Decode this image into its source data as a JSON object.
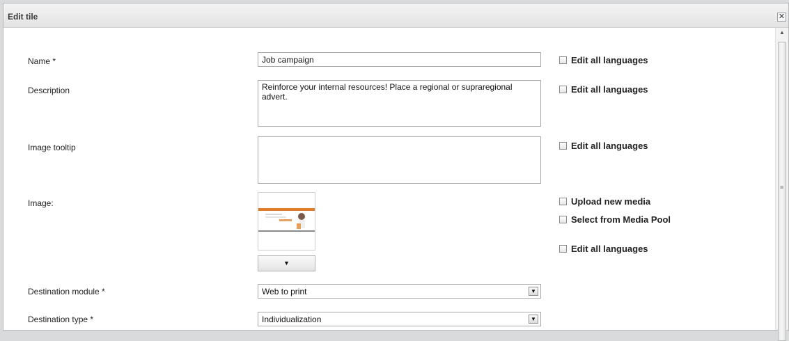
{
  "dialog": {
    "title": "Edit tile",
    "close_glyph": "✕"
  },
  "form": {
    "name": {
      "label": "Name *",
      "value": "Job campaign"
    },
    "description": {
      "label": "Description",
      "value": "Reinforce your internal resources! Place a regional or supraregional advert."
    },
    "image_tooltip": {
      "label": "Image tooltip",
      "value": ""
    },
    "image": {
      "label": "Image:",
      "dropdown_glyph": "▼"
    },
    "destination_module": {
      "label": "Destination module *",
      "value": "Web to print"
    },
    "destination_type": {
      "label": "Destination type *",
      "value": "Individualization"
    }
  },
  "options": {
    "edit_all_languages": "Edit all languages",
    "upload_new_media": "Upload new media",
    "select_from_media_pool": "Select from Media Pool"
  },
  "icons": {
    "close": "close-icon",
    "select_arrow": "chevron-down-icon",
    "scroll_up": "scroll-up-icon"
  },
  "colors": {
    "thumbnail_bar": "#e07b28",
    "thumbnail_line": "#8a8a8a"
  }
}
